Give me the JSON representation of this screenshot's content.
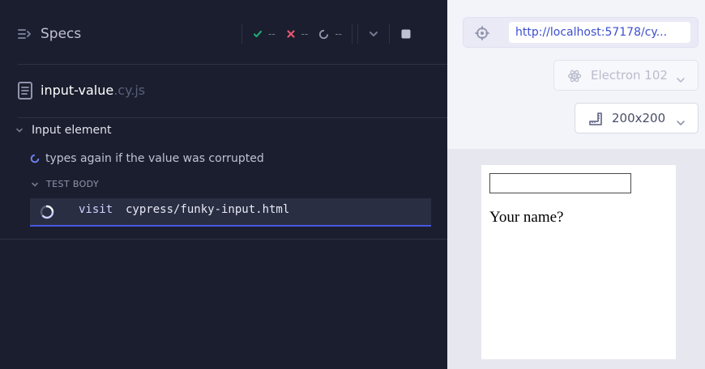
{
  "header": {
    "title": "Specs",
    "passed": "--",
    "failed": "--",
    "pending": "--"
  },
  "spec": {
    "name": "input-value",
    "ext": ".cy.js"
  },
  "suite": {
    "title": "Input element"
  },
  "test": {
    "title": "types again if the value was corrupted",
    "body_label": "TEST BODY"
  },
  "command": {
    "name": "visit",
    "arg": "cypress/funky-input.html"
  },
  "browser_bar": {
    "url": "http://localhost:57178/cy...",
    "browser": "Electron 102",
    "viewport": "200x200"
  },
  "aut": {
    "input_value": "",
    "label": "Your name?"
  },
  "colors": {
    "pass": "#1fa971",
    "fail": "#e45770",
    "accent": "#4956e3",
    "panel": "#1b1e2e"
  }
}
